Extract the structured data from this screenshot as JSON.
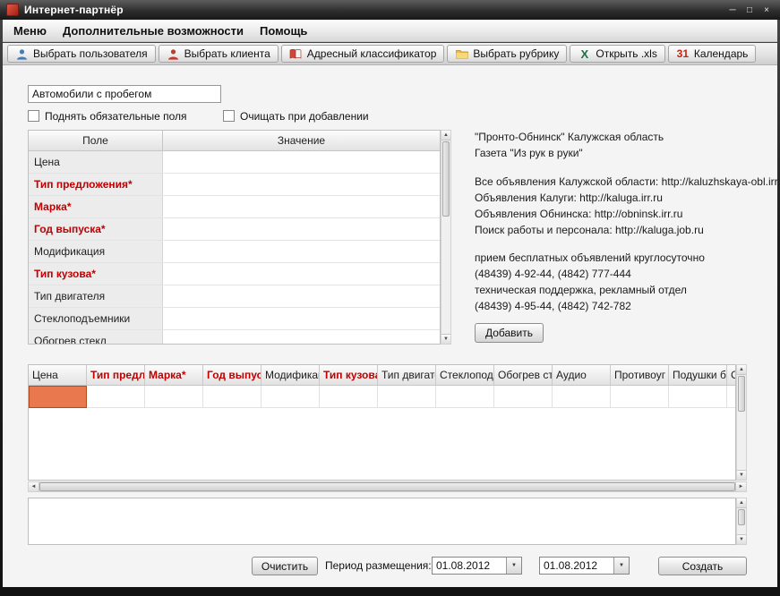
{
  "window": {
    "title": "Интернет-партнёр"
  },
  "glyphs": {
    "minimize": "─",
    "maximize": "□",
    "close": "×",
    "scroll_up": "▲",
    "scroll_down": "▼",
    "scroll_left": "◄",
    "scroll_right": "►",
    "dropdown": "▼"
  },
  "menubar": {
    "items": [
      {
        "label": "Меню"
      },
      {
        "label": "Дополнительные возможности"
      },
      {
        "label": "Помощь"
      }
    ]
  },
  "toolbar": {
    "buttons": [
      {
        "label": "Выбрать пользователя",
        "icon": "user-blue-icon"
      },
      {
        "label": "Выбрать клиента",
        "icon": "user-red-icon"
      },
      {
        "label": "Адресный классификатор",
        "icon": "address-book-icon"
      },
      {
        "label": "Выбрать рубрику",
        "icon": "folder-icon"
      },
      {
        "label": "Открыть .xls",
        "icon": "excel-icon",
        "icon_glyph": "X"
      },
      {
        "label": "Календарь",
        "icon": "calendar-icon",
        "icon_glyph": "31"
      }
    ]
  },
  "form": {
    "rubric_value": "Автомобили с пробегом",
    "checkboxes": [
      {
        "label": "Поднять обязательные поля",
        "checked": false
      },
      {
        "label": "Очищать при добавлении",
        "checked": false
      }
    ],
    "fields_table": {
      "col_field": "Поле",
      "col_value": "Значение",
      "rows": [
        {
          "label": "Цена",
          "required": false
        },
        {
          "label": "Тип предложения*",
          "required": true
        },
        {
          "label": "Марка*",
          "required": true
        },
        {
          "label": "Год выпуска*",
          "required": true
        },
        {
          "label": "Модификация",
          "required": false
        },
        {
          "label": "Тип кузова*",
          "required": true
        },
        {
          "label": "Тип двигателя",
          "required": false
        },
        {
          "label": "Стеклоподъемники",
          "required": false
        },
        {
          "label": "Обогрев стекл",
          "required": false
        }
      ]
    },
    "add_button": "Добавить"
  },
  "info": {
    "org_lines": [
      "\"Пронто-Обнинск\" Калужская область",
      "Газета \"Из рук в руки\""
    ],
    "links": [
      "Все объявления Калужской области: http://kaluzhskaya-obl.irr.ru",
      "Объявления Калуги: http://kaluga.irr.ru",
      "Объявления Обнинска: http://obninsk.irr.ru",
      "Поиск работы и персонала: http://kaluga.job.ru"
    ],
    "contact_lines": [
      "прием бесплатных объявлений круглосуточно",
      "(48439) 4-92-44, (4842) 777-444",
      "техническая поддержка, рекламный отдел",
      "(48439) 4-95-44, (4842) 742-782"
    ]
  },
  "grid": {
    "columns": [
      {
        "label": "Цена",
        "required": false
      },
      {
        "label": "Тип предло",
        "required": true
      },
      {
        "label": "Марка*",
        "required": true
      },
      {
        "label": "Год выпуск",
        "required": true
      },
      {
        "label": "Модификац",
        "required": false
      },
      {
        "label": "Тип кузова*",
        "required": true
      },
      {
        "label": "Тип двигате",
        "required": false
      },
      {
        "label": "Стеклопод",
        "required": false
      },
      {
        "label": "Обогрев ст",
        "required": false
      },
      {
        "label": "Аудио",
        "required": false
      },
      {
        "label": "Противоуг",
        "required": false
      },
      {
        "label": "Подушки бе",
        "required": false
      },
      {
        "label": "Си",
        "required": false
      }
    ],
    "selected_cell_color": "#e9784e"
  },
  "bottom": {
    "clear_button": "Очистить",
    "period_label": "Период размещения:",
    "date_from": "01.08.2012",
    "date_to": "01.08.2012",
    "create_button": "Создать"
  },
  "colors": {
    "required_text": "#c00000"
  }
}
